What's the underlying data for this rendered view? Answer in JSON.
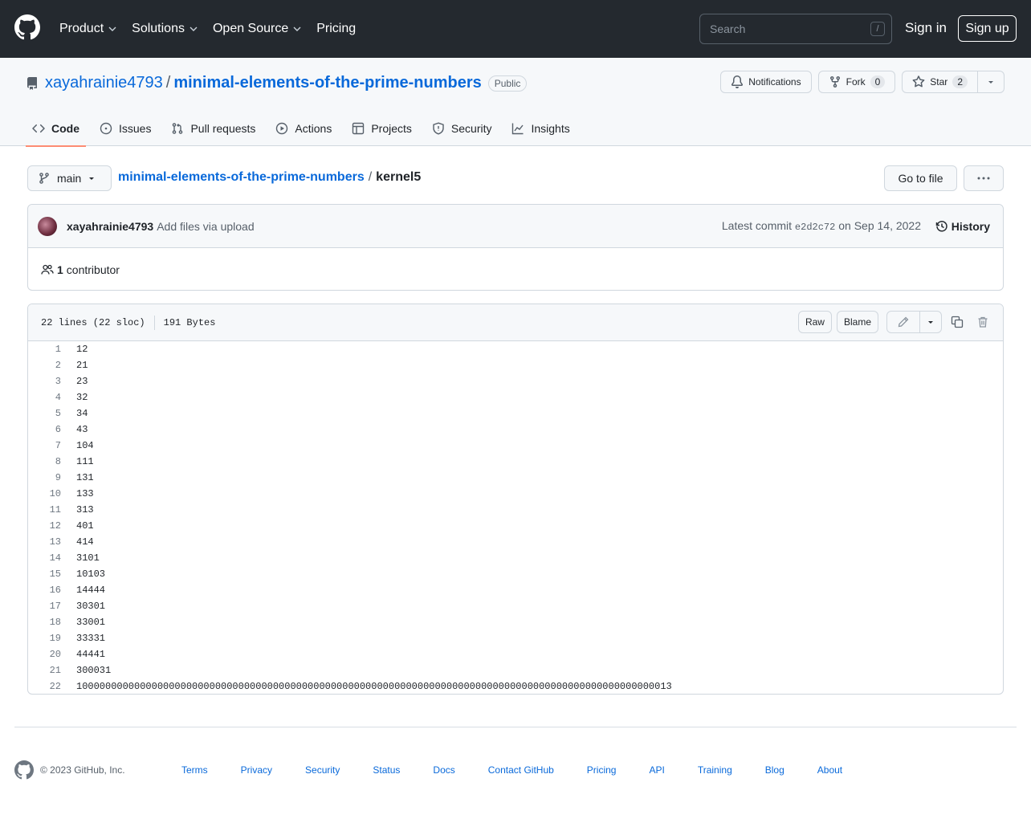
{
  "header": {
    "nav": [
      {
        "label": "Product",
        "dropdown": true
      },
      {
        "label": "Solutions",
        "dropdown": true
      },
      {
        "label": "Open Source",
        "dropdown": true
      },
      {
        "label": "Pricing",
        "dropdown": false
      }
    ],
    "search_placeholder": "Search",
    "search_shortcut": "/",
    "sign_in": "Sign in",
    "sign_up": "Sign up"
  },
  "repo": {
    "owner": "xayahrainie4793",
    "separator": "/",
    "name": "minimal-elements-of-the-prime-numbers",
    "visibility": "Public",
    "notifications_label": "Notifications",
    "fork_label": "Fork",
    "fork_count": "0",
    "star_label": "Star",
    "star_count": "2"
  },
  "tabs": [
    {
      "label": "Code",
      "icon": "code-icon",
      "selected": true
    },
    {
      "label": "Issues",
      "icon": "issue-opened-icon",
      "selected": false
    },
    {
      "label": "Pull requests",
      "icon": "git-pull-request-icon",
      "selected": false
    },
    {
      "label": "Actions",
      "icon": "play-icon",
      "selected": false
    },
    {
      "label": "Projects",
      "icon": "table-icon",
      "selected": false
    },
    {
      "label": "Security",
      "icon": "shield-icon",
      "selected": false
    },
    {
      "label": "Insights",
      "icon": "graph-icon",
      "selected": false
    }
  ],
  "file_nav": {
    "branch": "main",
    "breadcrumb_repo": "minimal-elements-of-the-prime-numbers",
    "breadcrumb_sep": "/",
    "file_name": "kernel5",
    "go_to_file": "Go to file"
  },
  "commit": {
    "author": "xayahrainie4793",
    "message": "Add files via upload",
    "latest_prefix": "Latest commit",
    "sha": "e2d2c72",
    "date": "on Sep 14, 2022",
    "history_label": "History",
    "contributor_count": "1",
    "contributor_label": "contributor"
  },
  "file": {
    "lines_info": "22 lines (22 sloc)",
    "size": "191 Bytes",
    "raw_label": "Raw",
    "blame_label": "Blame",
    "lines": [
      "12",
      "21",
      "23",
      "32",
      "34",
      "43",
      "104",
      "111",
      "131",
      "133",
      "313",
      "401",
      "414",
      "3101",
      "10103",
      "14444",
      "30301",
      "33001",
      "33331",
      "44441",
      "300031",
      "1000000000000000000000000000000000000000000000000000000000000000000000000000000000000000000000000000013"
    ]
  },
  "footer": {
    "copyright": "© 2023 GitHub, Inc.",
    "links": [
      "Terms",
      "Privacy",
      "Security",
      "Status",
      "Docs",
      "Contact GitHub",
      "Pricing",
      "API",
      "Training",
      "Blog",
      "About"
    ]
  },
  "colors": {
    "header_bg": "#24292f",
    "link": "#0969da",
    "tab_underline": "#fd8c73",
    "subtle_bg": "#f6f8fa",
    "border": "#d0d7de"
  }
}
